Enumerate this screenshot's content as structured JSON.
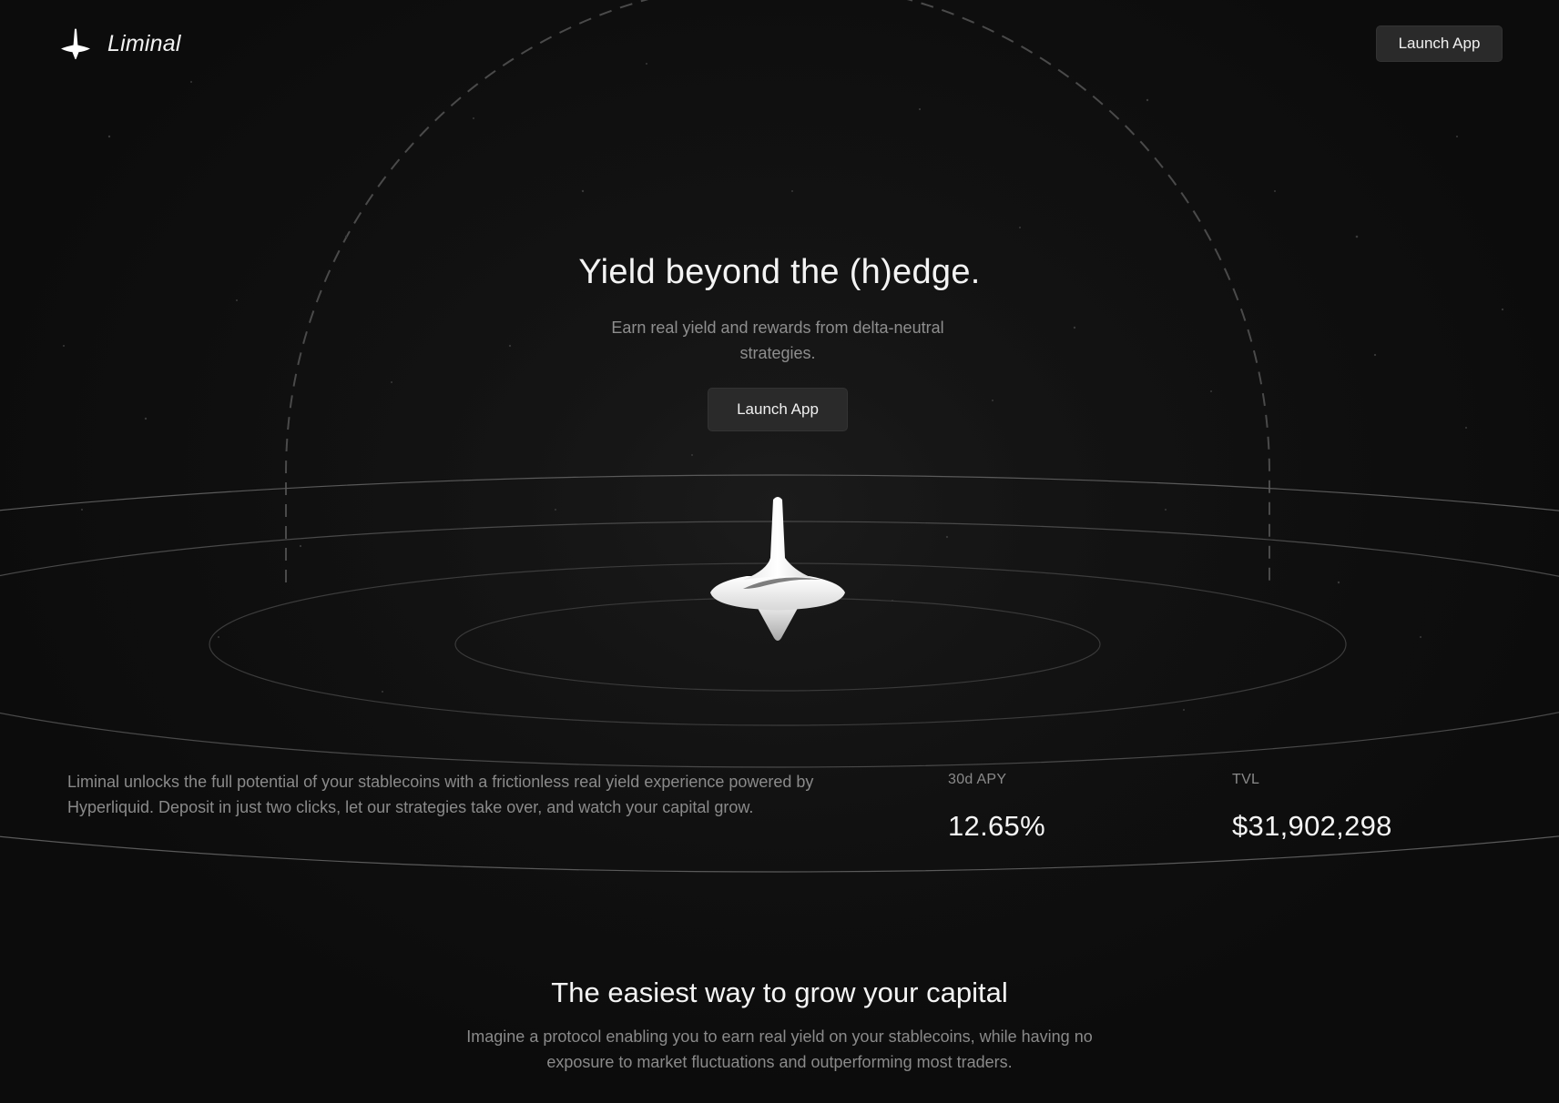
{
  "header": {
    "brand": "Liminal",
    "launch_label": "Launch App"
  },
  "hero": {
    "title": "Yield beyond the (h)edge.",
    "subtitle": "Earn real yield and rewards from delta-neutral strategies.",
    "launch_label": "Launch App"
  },
  "about": {
    "text": "Liminal unlocks the full potential of your stablecoins with a frictionless real yield experience powered by Hyperliquid. Deposit in just two clicks, let our strategies take over, and watch your capital grow."
  },
  "stats": [
    {
      "label": "30d APY",
      "value": "12.65%"
    },
    {
      "label": "TVL",
      "value": "$31,902,298"
    }
  ],
  "section": {
    "title": "The easiest way to grow your capital",
    "subtitle": "Imagine a protocol enabling you to earn real yield on your stablecoins, while having no exposure to market fluctuations and outperforming most traders."
  },
  "icons": {
    "logo": "spinning-top-icon",
    "hero": "spinning-top-icon"
  },
  "colors": {
    "background": "#0c0c0c",
    "button": "#2a2a2a",
    "text_primary": "#f4f4f4",
    "text_muted": "#8a8a8a"
  }
}
